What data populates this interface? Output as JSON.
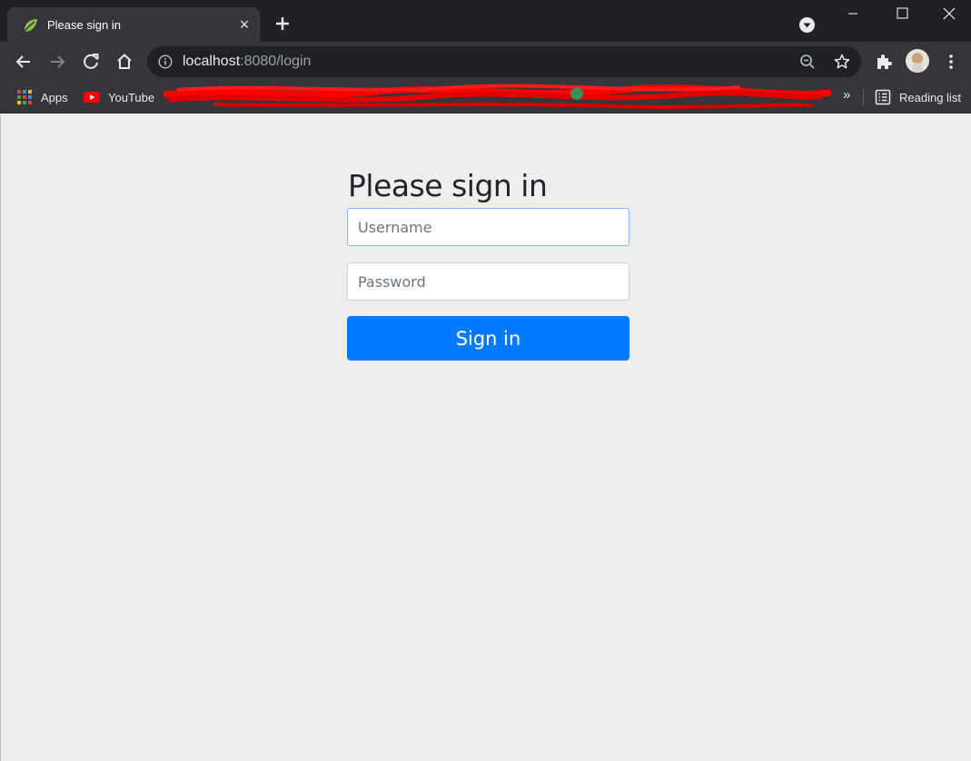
{
  "browser": {
    "tab": {
      "title": "Please sign in"
    },
    "address_bar": {
      "host": "localhost",
      "rest": ":8080/login"
    },
    "bookmarks": {
      "apps_label": "Apps",
      "youtube_label": "YouTube",
      "reading_list_label": "Reading list",
      "overflow_label": "»"
    }
  },
  "login": {
    "heading": "Please sign in",
    "username": {
      "placeholder": "Username",
      "value": ""
    },
    "password": {
      "placeholder": "Password",
      "value": ""
    },
    "submit_label": "Sign in"
  },
  "colors": {
    "primary_button": "#007bff",
    "page_background": "#eeeeee",
    "chrome_dark": "#202124",
    "chrome_toolbar": "#35363a"
  }
}
